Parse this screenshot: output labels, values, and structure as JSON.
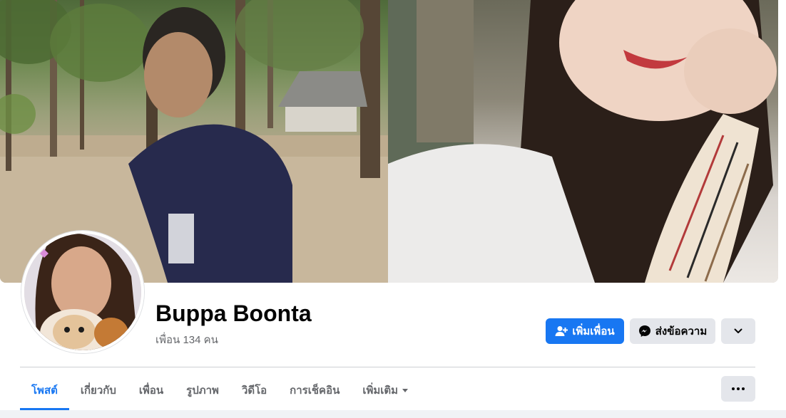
{
  "profile": {
    "name": "Buppa Boonta",
    "friends_text": "เพื่อน 134 คน"
  },
  "actions": {
    "add_friend_label": "เพิ่มเพื่อน",
    "message_label": "ส่งข้อความ"
  },
  "tabs": [
    {
      "label": "โพสต์",
      "active": true
    },
    {
      "label": "เกี่ยวกับ",
      "active": false
    },
    {
      "label": "เพื่อน",
      "active": false
    },
    {
      "label": "รูปภาพ",
      "active": false
    },
    {
      "label": "วิดีโอ",
      "active": false
    },
    {
      "label": "การเช็คอิน",
      "active": false
    },
    {
      "label": "เพิ่มเติม",
      "active": false
    }
  ],
  "icons": {
    "add_friend": "person-plus-icon",
    "message": "messenger-icon",
    "chevron": "chevron-down-icon",
    "more": "more-dots-icon",
    "tab_more_caret": "caret-down-icon"
  },
  "colors": {
    "accent": "#1877f2",
    "secondary_button": "#e4e6eb",
    "muted_text": "#65676b",
    "page_bg": "#f0f2f5"
  }
}
